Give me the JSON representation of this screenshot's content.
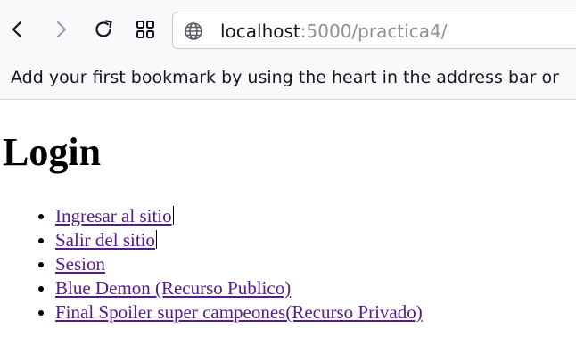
{
  "browser": {
    "url_host": "localhost",
    "url_rest": ":5000/practica4/",
    "icons": {
      "back": "chevron-left-icon",
      "forward": "chevron-right-icon",
      "reload": "reload-icon",
      "tabs": "grid-icon",
      "site": "globe-icon"
    }
  },
  "bookmarks_bar": {
    "message": "Add your first bookmark by using the heart in the address bar or"
  },
  "page": {
    "title": "Login",
    "links": [
      {
        "label": "Ingresar al sitio"
      },
      {
        "label": "Salir del sitio"
      },
      {
        "label": "Sesion"
      },
      {
        "label": "Blue Demon (Recurso Publico)"
      },
      {
        "label": "Final Spoiler super campeones(Recurso Privado)"
      }
    ]
  },
  "colors": {
    "link_visited": "#551a8b",
    "toolbar_bg": "#f9f9fb",
    "url_muted": "#8f8f9d"
  }
}
